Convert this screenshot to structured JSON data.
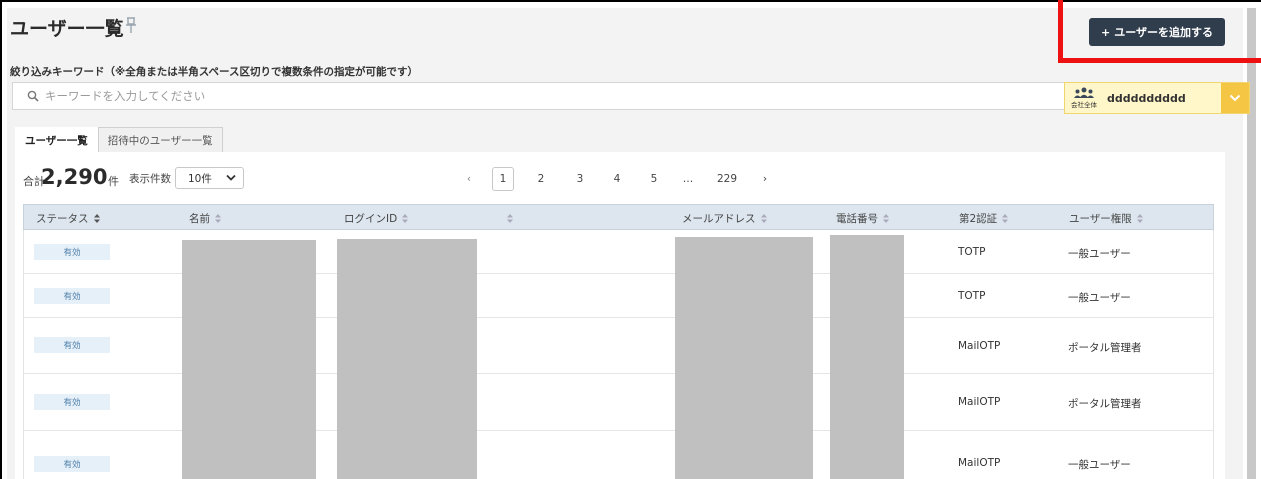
{
  "page": {
    "title": "ユーザー一覧",
    "add_user_label": "ユーザーを追加する",
    "add_user_plus": "+"
  },
  "filter": {
    "label": "絞り込みキーワード（※全角または半角スペース区切りで複数条件の指定が可能です）",
    "search_placeholder": "キーワードを入力してください"
  },
  "company": {
    "scope_label": "会社全体",
    "name": "dddddddddd"
  },
  "tabs": [
    {
      "label": "ユーザー一覧"
    },
    {
      "label": "招待中のユーザー一覧"
    }
  ],
  "summary": {
    "total_prefix": "合計",
    "total_count": "2,290",
    "total_suffix": "件",
    "per_page_label": "表示件数",
    "per_page_value": "10件"
  },
  "pagination": {
    "prev": "‹",
    "pages": [
      "1",
      "2",
      "3",
      "4",
      "5"
    ],
    "ellipsis": "…",
    "last": "229",
    "next": "›",
    "current": "1"
  },
  "table": {
    "headers": {
      "status": "ステータス",
      "name": "名前",
      "login_id": "ログインID",
      "blank": "",
      "email": "メールアドレス",
      "phone": "電話番号",
      "second_auth": "第2認証",
      "role": "ユーザー権限"
    },
    "rows": [
      {
        "status": "有効",
        "second_auth": "TOTP",
        "role": "一般ユーザー"
      },
      {
        "status": "有効",
        "second_auth": "TOTP",
        "role": "一般ユーザー"
      },
      {
        "status": "有効",
        "second_auth": "MailOTP",
        "role": "ポータル管理者"
      },
      {
        "status": "有効",
        "second_auth": "MailOTP",
        "role": "ポータル管理者"
      },
      {
        "status": "有効",
        "second_auth": "MailOTP",
        "role": "一般ユーザー"
      }
    ]
  },
  "colors": {
    "primary_button": "#2f3d4d",
    "highlight": "#ee1111",
    "company_bg": "#fff7c9",
    "company_accent": "#f5c644",
    "table_header": "#dde6ef",
    "status_badge": "#e6f0f8"
  }
}
